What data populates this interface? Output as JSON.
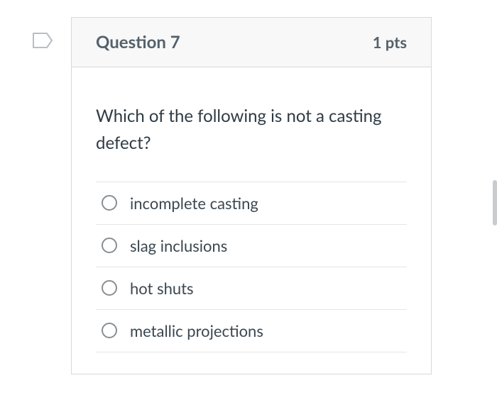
{
  "header": {
    "title": "Question 7",
    "points": "1 pts"
  },
  "question": {
    "prompt": "Which of the following is not a casting defect?"
  },
  "options": [
    {
      "label": "incomplete casting"
    },
    {
      "label": "slag inclusions"
    },
    {
      "label": "hot shuts"
    },
    {
      "label": "metallic projections"
    }
  ]
}
